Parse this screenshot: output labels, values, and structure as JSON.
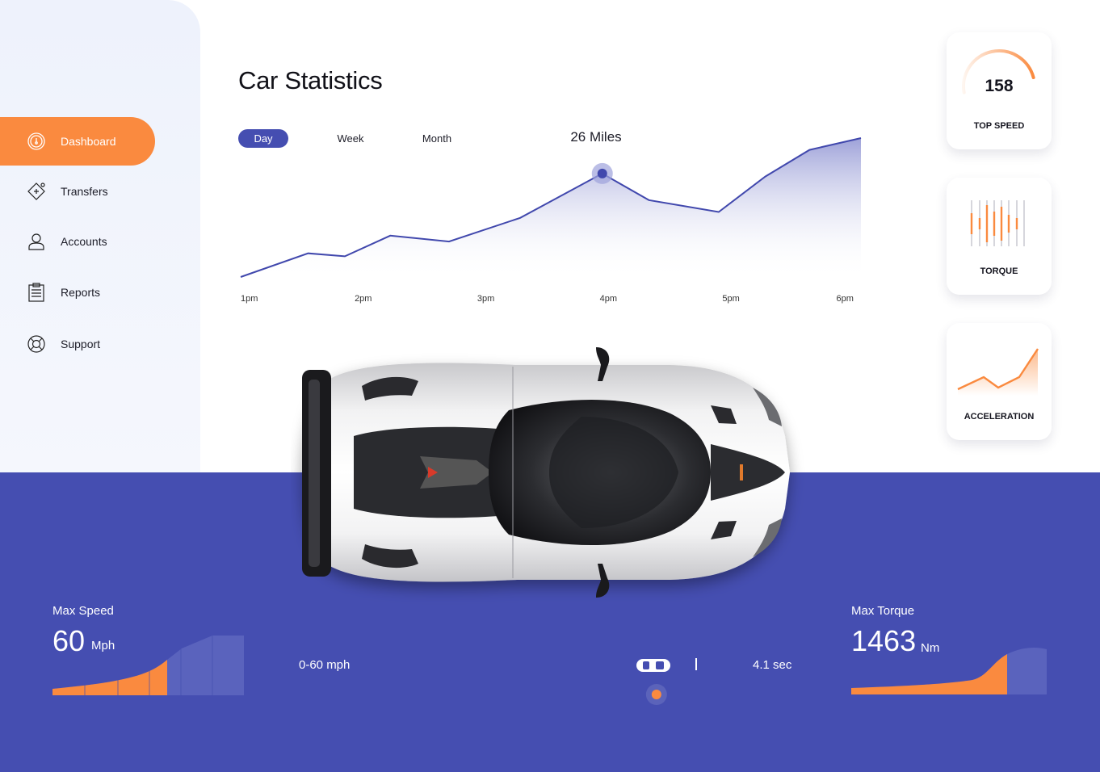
{
  "sidebar": {
    "items": [
      {
        "label": "Dashboard",
        "icon": "dashboard-icon"
      },
      {
        "label": "Transfers",
        "icon": "transfers-icon"
      },
      {
        "label": "Accounts",
        "icon": "user-icon"
      },
      {
        "label": "Reports",
        "icon": "clipboard-icon"
      },
      {
        "label": "Support",
        "icon": "lifebuoy-icon"
      }
    ],
    "active_index": 0
  },
  "header": {
    "title": "Car Statistics"
  },
  "tabs": [
    {
      "label": "Day"
    },
    {
      "label": "Week"
    },
    {
      "label": "Month"
    }
  ],
  "active_tab": "Day",
  "highlight": {
    "label": "26 Miles"
  },
  "colors": {
    "accent": "#fa8a3f",
    "brand": "#454eb1",
    "line": "#4148ad"
  },
  "chart_data": {
    "type": "area",
    "x_tick_labels": [
      "1pm",
      "2pm",
      "3pm",
      "4pm",
      "5pm",
      "6pm"
    ],
    "x_tick_positions": [
      1,
      2,
      3,
      4,
      5,
      6
    ],
    "points": [
      {
        "x": 1.0,
        "y": 0
      },
      {
        "x": 1.55,
        "y": 8
      },
      {
        "x": 1.85,
        "y": 7
      },
      {
        "x": 2.22,
        "y": 14
      },
      {
        "x": 2.7,
        "y": 12
      },
      {
        "x": 3.28,
        "y": 20
      },
      {
        "x": 3.95,
        "y": 35
      },
      {
        "x": 4.33,
        "y": 26
      },
      {
        "x": 4.9,
        "y": 22
      },
      {
        "x": 5.28,
        "y": 34
      },
      {
        "x": 5.64,
        "y": 43
      },
      {
        "x": 6.06,
        "y": 47
      }
    ],
    "highlight_point_index": 6,
    "ylim": [
      0,
      50
    ],
    "xlim": [
      1,
      6.06
    ],
    "grid": false
  },
  "cards": {
    "top_speed": {
      "value": "158",
      "label": "TOP SPEED",
      "gauge_fraction": 0.65
    },
    "torque": {
      "label": "TORQUE"
    },
    "acceleration": {
      "label": "ACCELERATION"
    }
  },
  "bottom": {
    "max_speed": {
      "label": "Max Speed",
      "value": "60",
      "unit": "Mph"
    },
    "zero_sixty": {
      "label": "0-60 mph",
      "value": "4.1 sec",
      "progress": 0.74
    },
    "max_torque": {
      "label": "Max Torque",
      "value": "1463",
      "unit": "Nm"
    }
  }
}
